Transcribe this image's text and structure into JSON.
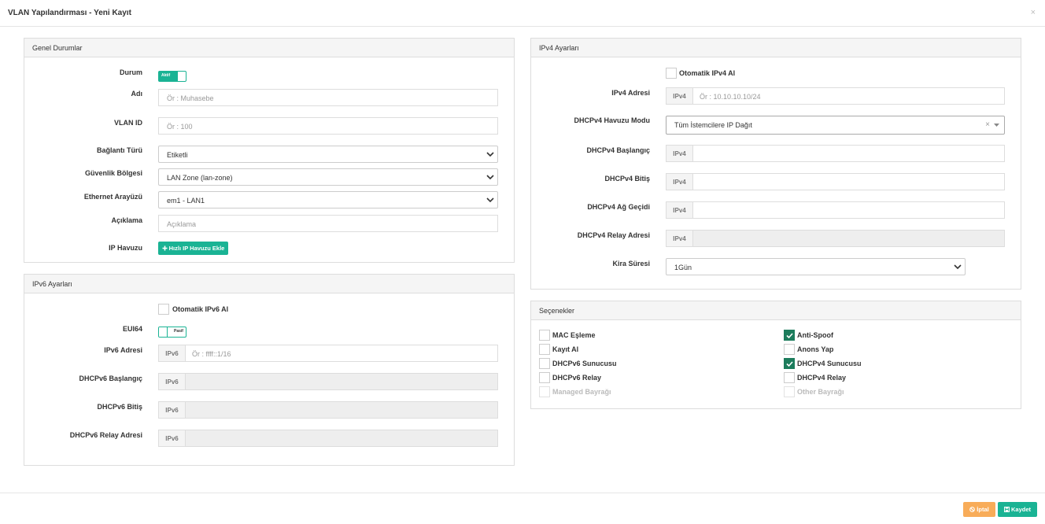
{
  "modal": {
    "title": "VLAN Yapılandırması - Yeni Kayıt",
    "close_icon": "×"
  },
  "general": {
    "heading": "Genel Durumlar",
    "status_label": "Durum",
    "status_toggle_text": "Aktif",
    "status_on": true,
    "name_label": "Adı",
    "name_placeholder": "Ör : Muhasebe",
    "vlan_id_label": "VLAN ID",
    "vlan_id_placeholder": "Ör : 100",
    "connection_type_label": "Bağlantı Türü",
    "connection_type_value": "Etiketli",
    "security_zone_label": "Güvenlik Bölgesi",
    "security_zone_value": "LAN Zone (lan-zone)",
    "ethernet_label": "Ethernet Arayüzü",
    "ethernet_value": "em1 - LAN1",
    "description_label": "Açıklama",
    "description_placeholder": "Açıklama",
    "ip_pool_label": "IP Havuzu",
    "ip_pool_button": "Hızlı IP Havuzu Ekle",
    "ip_pool_button_icon": "plus-icon"
  },
  "ipv6": {
    "heading": "IPv6 Ayarları",
    "auto_label": "Otomatik IPv6 Al",
    "eui64_label": "EUI64",
    "eui64_toggle_text": "Pasif",
    "eui64_on": false,
    "addr_label": "IPv6 Adresi",
    "addon": "IPv6",
    "addr_placeholder": "Ör : ffff::1/16",
    "dhcp_start_label": "DHCPv6 Başlangıç",
    "dhcp_end_label": "DHCPv6 Bitiş",
    "dhcp_relay_label": "DHCPv6 Relay Adresi"
  },
  "ipv4": {
    "heading": "IPv4 Ayarları",
    "auto_label": "Otomatik IPv4 Al",
    "addr_label": "IPv4 Adresi",
    "addon": "IPv4",
    "addr_placeholder": "Ör : 10.10.10.10/24",
    "pool_mode_label": "DHCPv4 Havuzu Modu",
    "pool_mode_value": "Tüm İstemcilere IP Dağıt",
    "pool_mode_clear": "×",
    "dhcp_start_label": "DHCPv4 Başlangıç",
    "dhcp_end_label": "DHCPv4 Bitiş",
    "gateway_label": "DHCPv4 Ağ Geçidi",
    "relay_label": "DHCPv4 Relay Adresi",
    "lease_label": "Kira Süresi",
    "lease_value": "1Gün"
  },
  "options": {
    "heading": "Seçenekler",
    "left": [
      {
        "label": "MAC Eşleme",
        "checked": false,
        "disabled": false
      },
      {
        "label": "Kayıt Al",
        "checked": false,
        "disabled": false
      },
      {
        "label": "DHCPv6 Sunucusu",
        "checked": false,
        "disabled": false
      },
      {
        "label": "DHCPv6 Relay",
        "checked": false,
        "disabled": false
      },
      {
        "label": "Managed Bayrağı",
        "checked": false,
        "disabled": true
      }
    ],
    "right": [
      {
        "label": "Anti-Spoof",
        "checked": true,
        "disabled": false
      },
      {
        "label": "Anons Yap",
        "checked": false,
        "disabled": false
      },
      {
        "label": "DHCPv4 Sunucusu",
        "checked": true,
        "disabled": false
      },
      {
        "label": "DHCPv4 Relay",
        "checked": false,
        "disabled": false
      },
      {
        "label": "Other Bayrağı",
        "checked": false,
        "disabled": true
      }
    ]
  },
  "footer": {
    "cancel_label": "İptal",
    "cancel_icon": "ban-icon",
    "save_label": "Kaydet",
    "save_icon": "floppy-icon"
  },
  "colors": {
    "accent": "#1ab394",
    "checkbox_checked": "#1c7c5c",
    "cancel": "#f8ac59"
  }
}
